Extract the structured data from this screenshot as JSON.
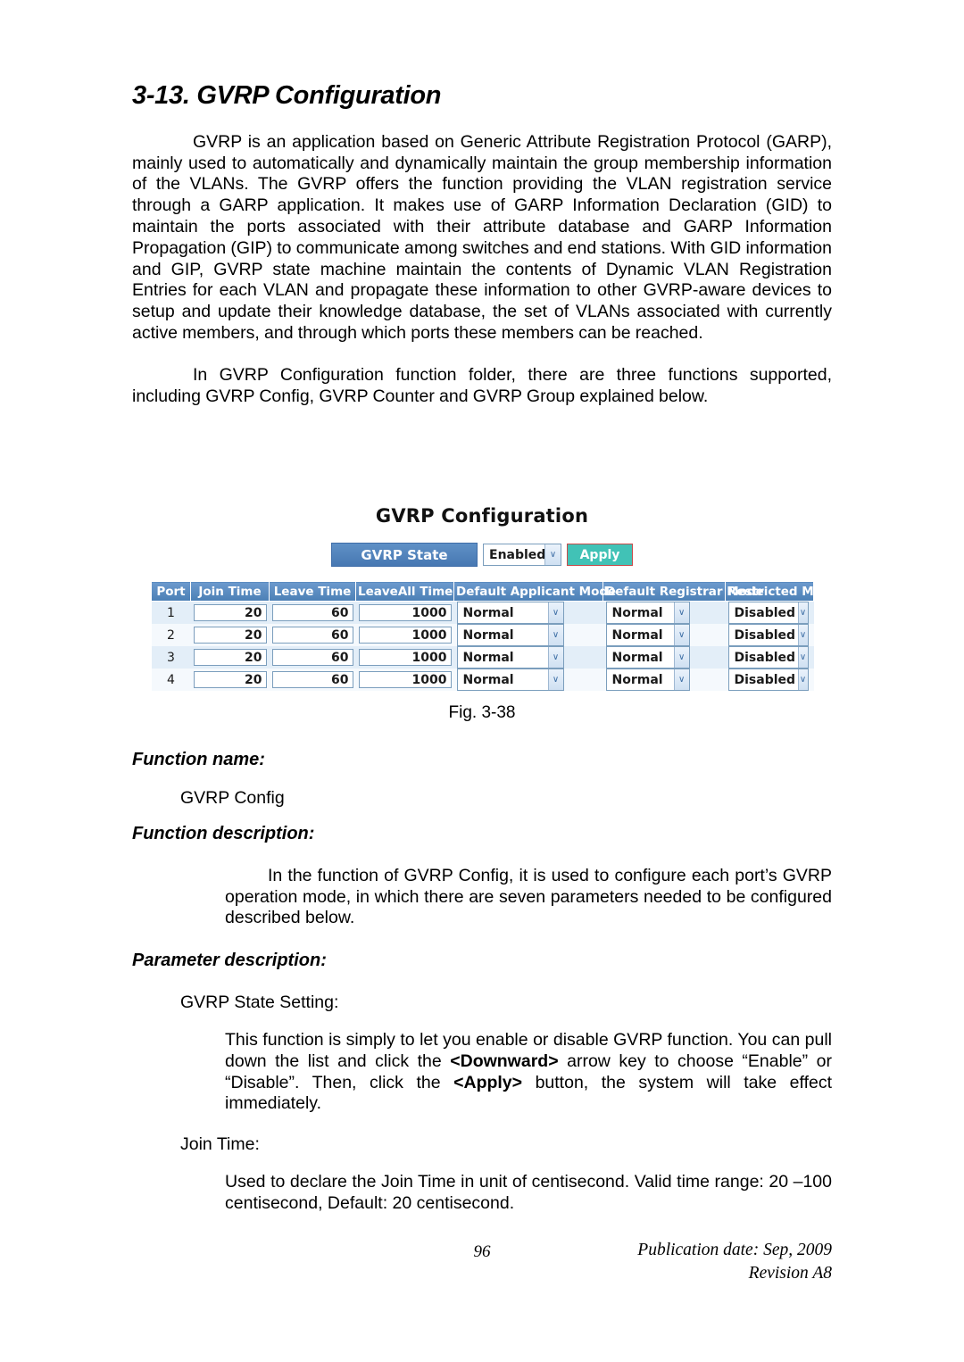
{
  "section": {
    "number": "3-13.",
    "title": "GVRP Configuration",
    "heading": "3-13. GVRP Configuration"
  },
  "body": {
    "paragraph1": "GVRP is an application based on Generic Attribute Registration Protocol (GARP), mainly used to automatically and dynamically maintain the group membership information of the VLANs. The GVRP offers the function providing the VLAN registration service through a GARP application. It makes use of GARP Information Declaration (GID) to maintain the ports associated with their attribute database and GARP Information Propagation (GIP) to communicate among switches and end stations. With GID information and GIP, GVRP state machine maintain the contents of Dynamic VLAN Registration Entries for each VLAN and propagate these information to other GVRP-aware devices to setup and update their knowledge database, the set of VLANs associated with currently active members, and through which ports these members can be reached.",
    "paragraph2": "In GVRP Configuration function folder, there are three functions supported, including GVRP Config, GVRP Counter and GVRP Group explained below."
  },
  "figure": {
    "caption": "Fig. 3-38",
    "ui_title": "GVRP Configuration",
    "state_label": "GVRP State",
    "state_value": "Enabled",
    "apply_label": "Apply",
    "dropdown_arrow": "∨",
    "columns": [
      "Port",
      "Join Time",
      "Leave Time",
      "LeaveAll Time",
      "Default Applicant Mode",
      "Default Registrar Mode",
      "Restricted Mode"
    ],
    "rows": [
      {
        "port": "1",
        "join_time": "20",
        "leave_time": "60",
        "leaveall_time": "1000",
        "applicant_mode": "Normal",
        "registrar_mode": "Normal",
        "restricted_mode": "Disabled"
      },
      {
        "port": "2",
        "join_time": "20",
        "leave_time": "60",
        "leaveall_time": "1000",
        "applicant_mode": "Normal",
        "registrar_mode": "Normal",
        "restricted_mode": "Disabled"
      },
      {
        "port": "3",
        "join_time": "20",
        "leave_time": "60",
        "leaveall_time": "1000",
        "applicant_mode": "Normal",
        "registrar_mode": "Normal",
        "restricted_mode": "Disabled"
      },
      {
        "port": "4",
        "join_time": "20",
        "leave_time": "60",
        "leaveall_time": "1000",
        "applicant_mode": "Normal",
        "registrar_mode": "Normal",
        "restricted_mode": "Disabled"
      }
    ],
    "colors": {
      "header_blue": "#4b7fb5",
      "row_stripe": "#e3eef8",
      "apply_teal": "#41c2b6",
      "select_border": "#7b9ebd"
    }
  },
  "sections": {
    "function_name_heading": "Function name:",
    "function_name_value": "GVRP Config",
    "function_description_heading": "Function description:",
    "function_description_text": "In the function of GVRP Config, it is used to configure each port’s GVRP operation mode, in which there are seven parameters needed to be configured described below.",
    "parameter_description_heading": "Parameter description:",
    "param1_label": "GVRP State Setting:",
    "param1_text_part1": "This function is simply to let you enable or disable GVRP function. You can pull down the list and click the ",
    "param1_bold1": "<Downward>",
    "param1_text_part2": " arrow key to choose “Enable” or “Disable”.  Then, click the ",
    "param1_bold2": "<Apply>",
    "param1_text_part3": " button, the system will take effect immediately.",
    "param2_label": "Join Time:",
    "param2_text": "Used to declare the Join Time in unit of centisecond. Valid time range: 20 –100 centisecond, Default: 20 centisecond."
  },
  "footer": {
    "page_number": "96",
    "publication": "Publication date: Sep, 2009",
    "revision": "Revision A8"
  }
}
